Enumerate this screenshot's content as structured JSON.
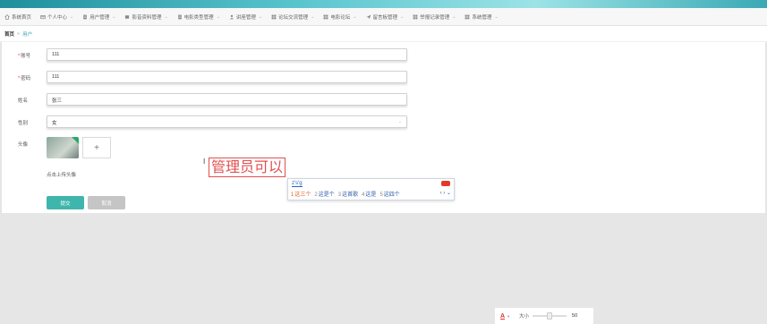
{
  "nav": {
    "items": [
      {
        "label": "系统首页",
        "icon": "home-icon",
        "caret": false
      },
      {
        "label": "个人中心",
        "icon": "mail-icon",
        "caret": true
      },
      {
        "label": "用户管理",
        "icon": "doc-icon",
        "caret": true
      },
      {
        "label": "影音资料管理",
        "icon": "box-icon",
        "caret": true
      },
      {
        "label": "电影类型管理",
        "icon": "doc-icon",
        "caret": true
      },
      {
        "label": "讲座管理",
        "icon": "user-icon",
        "caret": true
      },
      {
        "label": "论坛交流管理",
        "icon": "grid-icon",
        "caret": true
      },
      {
        "label": "电影论坛",
        "icon": "grid-icon",
        "caret": true
      },
      {
        "label": "留言板管理",
        "icon": "send-icon",
        "caret": true
      },
      {
        "label": "举报记录管理",
        "icon": "grid-icon",
        "caret": true
      },
      {
        "label": "系统管理",
        "icon": "grid-icon",
        "caret": true
      }
    ]
  },
  "breadcrumb": {
    "home": "首页",
    "separator": "»",
    "current": "用户"
  },
  "form": {
    "account": {
      "label": "账号",
      "value": "111"
    },
    "password": {
      "label": "密码",
      "value": "111"
    },
    "name": {
      "label": "姓名",
      "value": "张三"
    },
    "gender": {
      "label": "性别",
      "value": "女"
    },
    "avatar": {
      "label": "头像",
      "upload_plus": "+",
      "tip": "点击上传头像"
    },
    "required_mark": "*"
  },
  "buttons": {
    "submit": "提交",
    "cancel": "取消"
  },
  "ime": {
    "composed_text": "管理员可以",
    "input": "z's'g",
    "candidates": [
      {
        "n": "1",
        "text": "这三个"
      },
      {
        "n": "2",
        "text": "这是个"
      },
      {
        "n": "3",
        "text": "这首歌"
      },
      {
        "n": "4",
        "text": "这是"
      },
      {
        "n": "5",
        "text": "这四个"
      }
    ],
    "nav": "‹ › ⌄"
  },
  "zoom": {
    "font_icon": "A",
    "label": "大小",
    "value": "50",
    "level_fraction": 0.5
  },
  "colors": {
    "accent": "#3fb6ad",
    "required": "#e33333",
    "ime_red": "#e05050"
  }
}
